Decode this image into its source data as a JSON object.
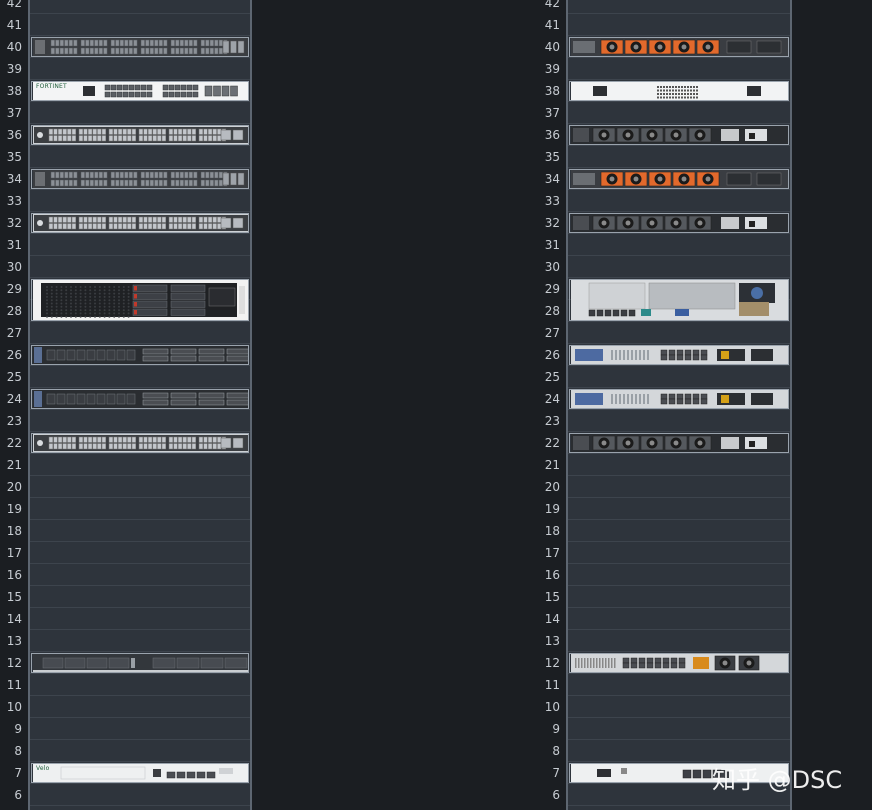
{
  "rack_units": [
    "42",
    "41",
    "40",
    "39",
    "38",
    "37",
    "36",
    "35",
    "34",
    "33",
    "32",
    "31",
    "30",
    "29",
    "28",
    "27",
    "26",
    "25",
    "24",
    "23",
    "22",
    "21",
    "20",
    "19",
    "18",
    "17",
    "16",
    "15",
    "14",
    "13",
    "12",
    "11",
    "10",
    "9",
    "8",
    "7",
    "6"
  ],
  "front_rack": {
    "devices": [
      {
        "name": "switch-48port-u40",
        "u": 40,
        "height": 1,
        "type": "switch-dark"
      },
      {
        "name": "firewall-u38",
        "u": 38,
        "height": 1,
        "type": "firewall-white",
        "label": "FORTINET"
      },
      {
        "name": "switch-sfp-u36",
        "u": 36,
        "height": 1,
        "type": "switch-silver"
      },
      {
        "name": "switch-48port-u34",
        "u": 34,
        "height": 1,
        "type": "switch-dark"
      },
      {
        "name": "switch-sfp-u32",
        "u": 32,
        "height": 1,
        "type": "switch-silver"
      },
      {
        "name": "server-2u-u28",
        "u": 28,
        "height": 2,
        "type": "server-2u-front"
      },
      {
        "name": "server-1u-u26",
        "u": 26,
        "height": 1,
        "type": "server-1u-front"
      },
      {
        "name": "server-1u-u24",
        "u": 24,
        "height": 1,
        "type": "server-1u-front"
      },
      {
        "name": "switch-sfp-u22",
        "u": 22,
        "height": 1,
        "type": "switch-silver"
      },
      {
        "name": "server-1u-u12",
        "u": 12,
        "height": 1,
        "type": "server-1u-slim"
      },
      {
        "name": "appliance-u7",
        "u": 7,
        "height": 1,
        "type": "appliance-white",
        "label": "Velo"
      }
    ]
  },
  "rear_rack": {
    "devices": [
      {
        "name": "switch-rear-fans-orange-u40",
        "u": 40,
        "height": 1,
        "type": "rear-orange"
      },
      {
        "name": "firewall-rear-u38",
        "u": 38,
        "height": 1,
        "type": "rear-white"
      },
      {
        "name": "switch-rear-fans-u36",
        "u": 36,
        "height": 1,
        "type": "rear-dark"
      },
      {
        "name": "switch-rear-fans-orange-u34",
        "u": 34,
        "height": 1,
        "type": "rear-orange"
      },
      {
        "name": "switch-rear-fans-u32",
        "u": 32,
        "height": 1,
        "type": "rear-dark"
      },
      {
        "name": "server-rear-2u-u28",
        "u": 28,
        "height": 2,
        "type": "rear-server-2u"
      },
      {
        "name": "server-rear-1u-u26",
        "u": 26,
        "height": 1,
        "type": "rear-server-1u"
      },
      {
        "name": "server-rear-1u-u24",
        "u": 24,
        "height": 1,
        "type": "rear-server-1u"
      },
      {
        "name": "switch-rear-fans-u22",
        "u": 22,
        "height": 1,
        "type": "rear-dark"
      },
      {
        "name": "server-rear-1u-u12",
        "u": 12,
        "height": 1,
        "type": "rear-server-1u-b"
      },
      {
        "name": "appliance-rear-u7",
        "u": 7,
        "height": 1,
        "type": "rear-white-b"
      }
    ]
  },
  "watermark": "知乎 @DSC",
  "colors": {
    "background": "#1b1e22",
    "rack_body": "#2e343c",
    "rail": "#5d6671",
    "unit_text": "#c7ccd2",
    "orange_fan": "#e2692c"
  }
}
